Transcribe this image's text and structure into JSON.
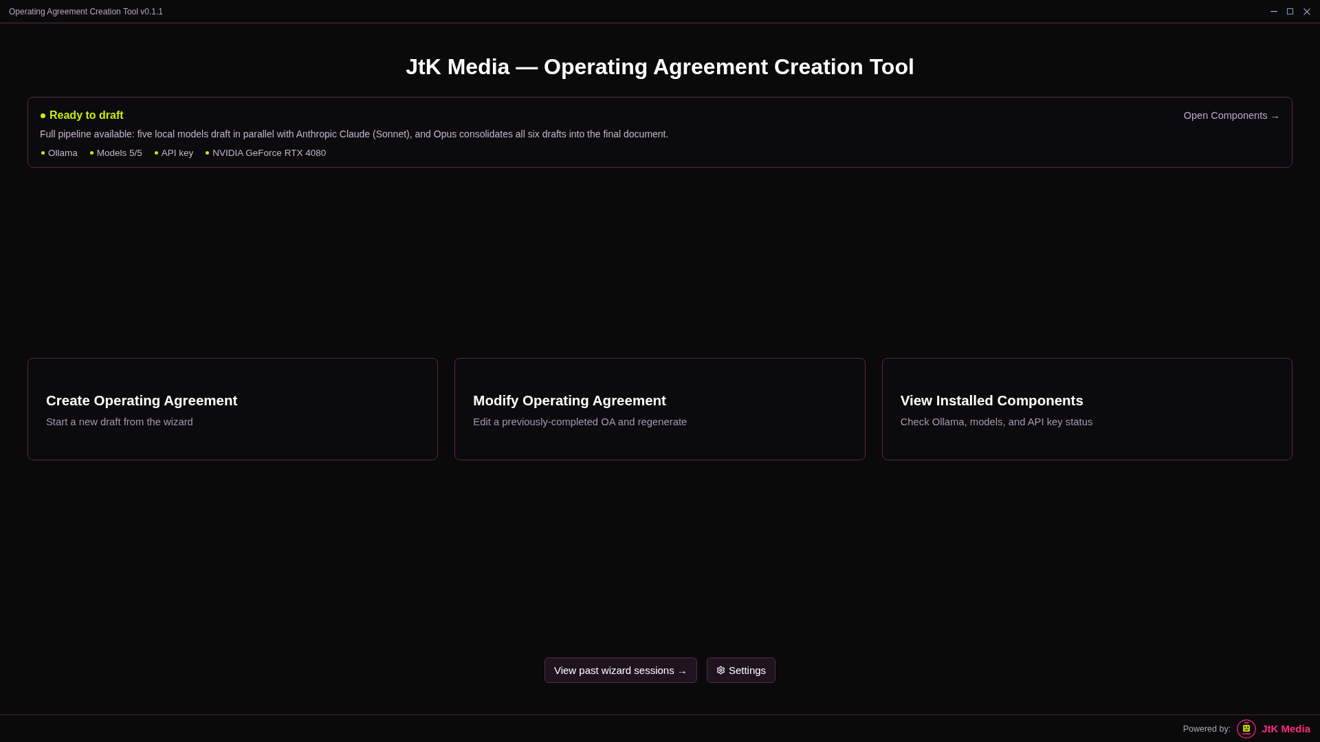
{
  "window": {
    "title": "Operating Agreement Creation Tool v0.1.1"
  },
  "heading": "JtK Media — Operating Agreement Creation Tool",
  "status_panel": {
    "ready": true,
    "title": "Ready to draft",
    "link": "Open Components →",
    "description": "Full pipeline available: five local models draft in parallel with Anthropic Claude (Sonnet), and Opus consolidates all six drafts into the final document.",
    "checks": [
      {
        "label": "Ollama",
        "ok": true
      },
      {
        "label": "Models 5/5",
        "ok": true
      },
      {
        "label": "API key",
        "ok": true
      },
      {
        "label": "NVIDIA GeForce RTX 4080",
        "ok": true
      }
    ]
  },
  "cards": [
    {
      "title": "Create Operating Agreement",
      "subtitle": "Start a new draft from the wizard"
    },
    {
      "title": "Modify Operating Agreement",
      "subtitle": "Edit a previously-completed OA and regenerate"
    },
    {
      "title": "View Installed Components",
      "subtitle": "Check Ollama, models, and API key status"
    }
  ],
  "actions": [
    {
      "kind": "link",
      "label": "View past wizard sessions →"
    },
    {
      "kind": "settings",
      "label": "Settings"
    }
  ],
  "footer": {
    "label": "Powered by:",
    "brand": "JtK Media"
  }
}
